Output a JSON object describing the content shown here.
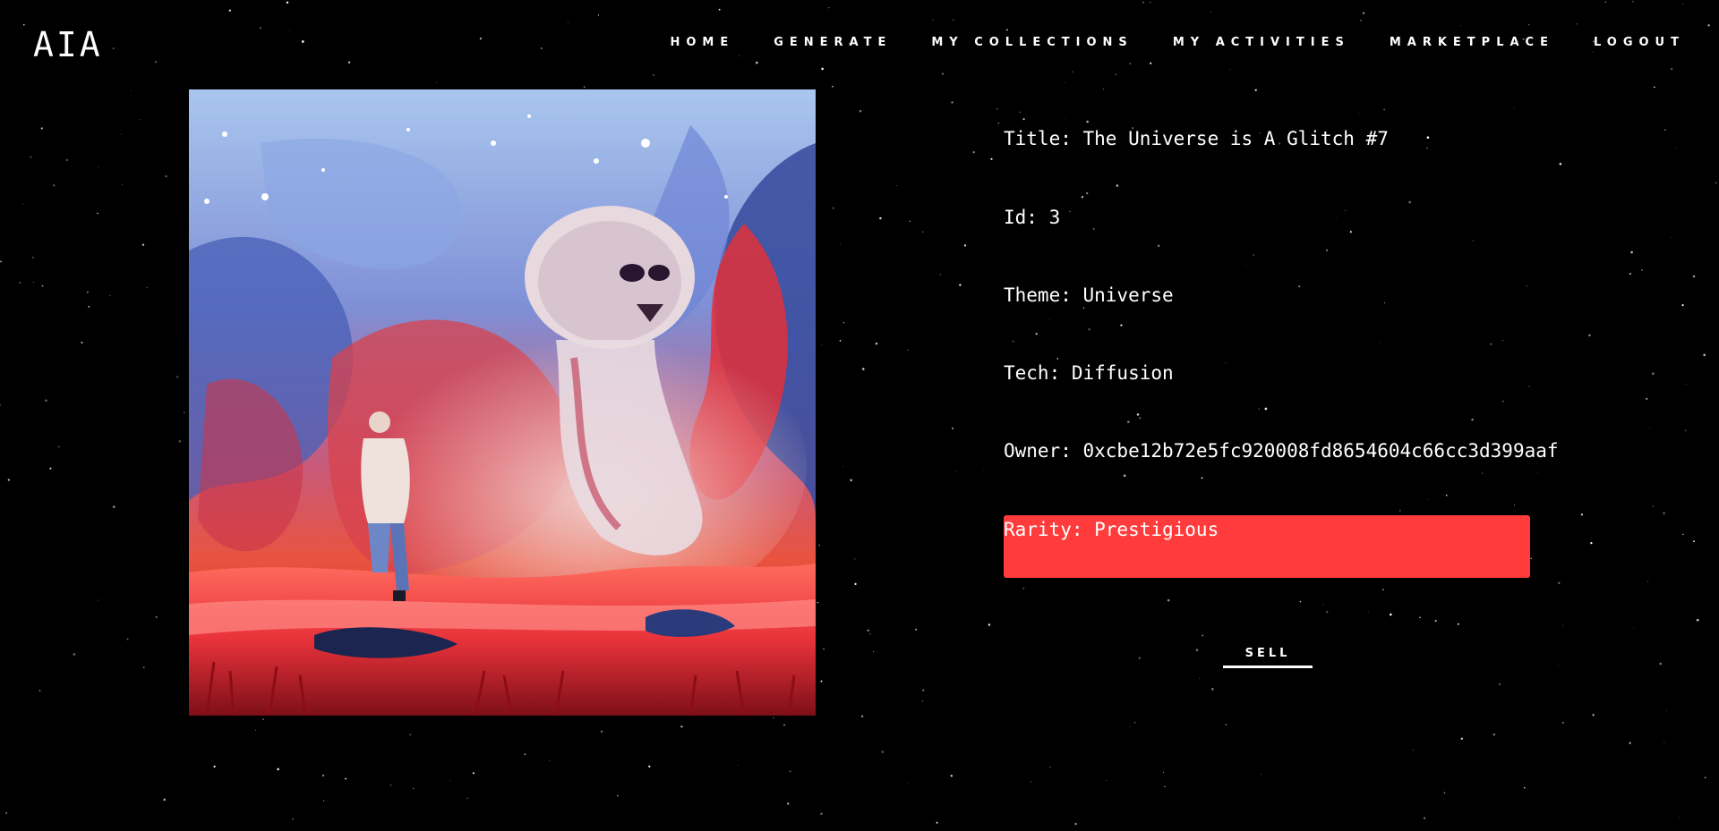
{
  "header": {
    "logo": "AIA",
    "nav": [
      "HOME",
      "GENERATE",
      "MY COLLECTIONS",
      "MY ACTIVITIES",
      "MARKETPLACE",
      "LOGOUT"
    ]
  },
  "artwork": {
    "colors": {
      "sky_top": "#9cbde6",
      "sky_mid": "#6a78c8",
      "red": "#e83a3e",
      "deep_red": "#b3121e",
      "blue": "#3a4fa0"
    }
  },
  "details": {
    "title": "Title: The Universe is A Glitch #7",
    "id": "Id: 3",
    "theme": "Theme: Universe",
    "tech": "Tech: Diffusion",
    "owner": "Owner: 0xcbe12b72e5fc920008fd8654604c66cc3d399aaf",
    "rarity": "Rarity: Prestigious"
  },
  "actions": {
    "sell_label": "SELL"
  },
  "colors": {
    "background": "#000000",
    "rarity_badge": "#ff3b3b",
    "text": "#ffffff"
  }
}
